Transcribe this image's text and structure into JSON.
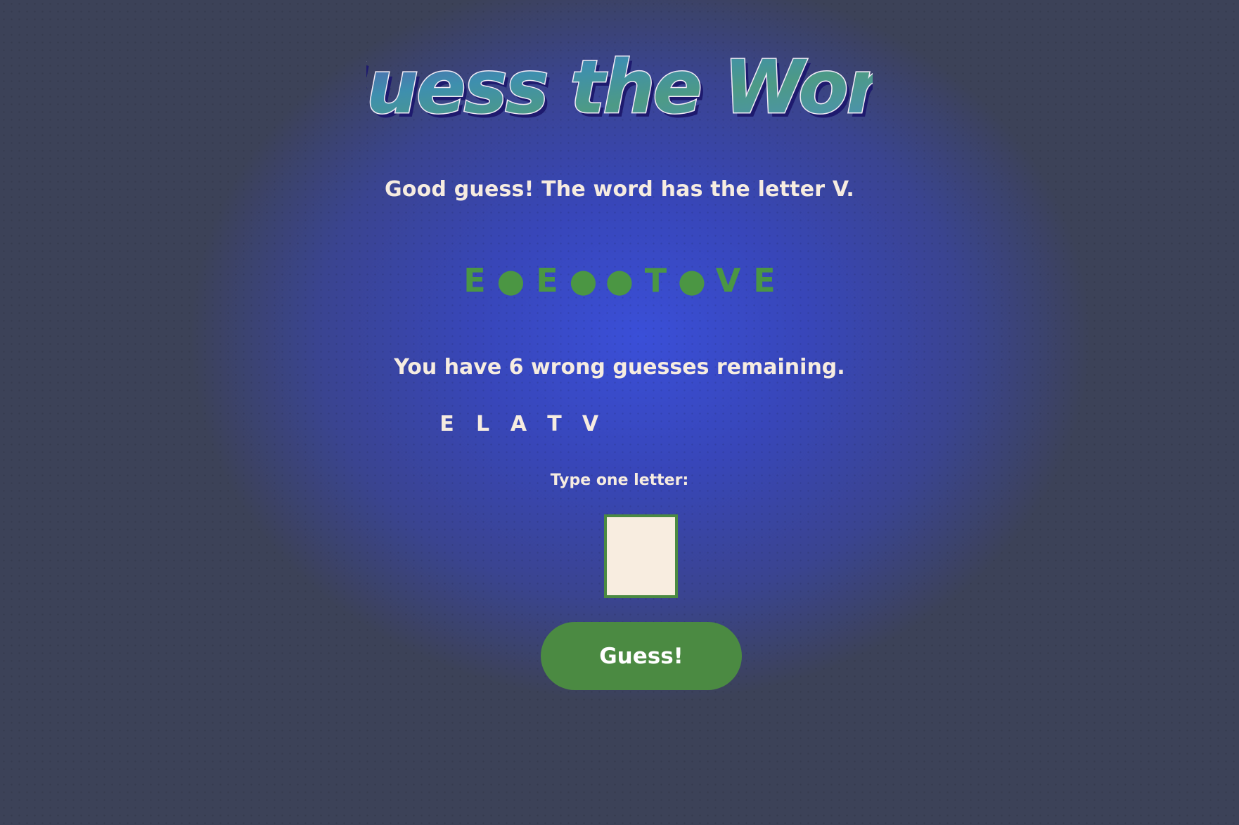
{
  "game": {
    "title": "Guess the Word",
    "message": "Good guess! The word has the letter V.",
    "word_progress": [
      "E",
      "●",
      "E",
      "●",
      "●",
      "T",
      "●",
      "V",
      "E"
    ],
    "remaining_text": "You have 6 wrong guesses remaining.",
    "guessed_letters": [
      "E",
      "L",
      "A",
      "T",
      "V"
    ],
    "input_label": "Type one letter:",
    "input_value": "",
    "button_label": "Guess!"
  },
  "colors": {
    "background_center": "#3a4fd8",
    "background_edge": "#3c4258",
    "text_cream": "#f6ece0",
    "accent_green": "#4b8a42",
    "word_green": "#4b9643",
    "input_background": "#f8ede0"
  }
}
